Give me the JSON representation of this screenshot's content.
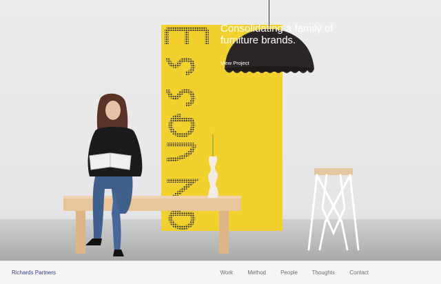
{
  "hero": {
    "headline": "Consolidating a family of furniture brands.",
    "cta_label": "View Project",
    "panel_word": "essenze",
    "colors": {
      "panel": "#f2d12f",
      "text_on_image": "#ffffff"
    }
  },
  "navbar": {
    "brand": "Richards Partners",
    "items": [
      {
        "label": "Work"
      },
      {
        "label": "Method"
      },
      {
        "label": "People"
      },
      {
        "label": "Thoughts"
      },
      {
        "label": "Contact"
      }
    ],
    "colors": {
      "brand": "#2f3e86",
      "nav": "#6c6c74",
      "background": "#f5f5f5"
    }
  }
}
